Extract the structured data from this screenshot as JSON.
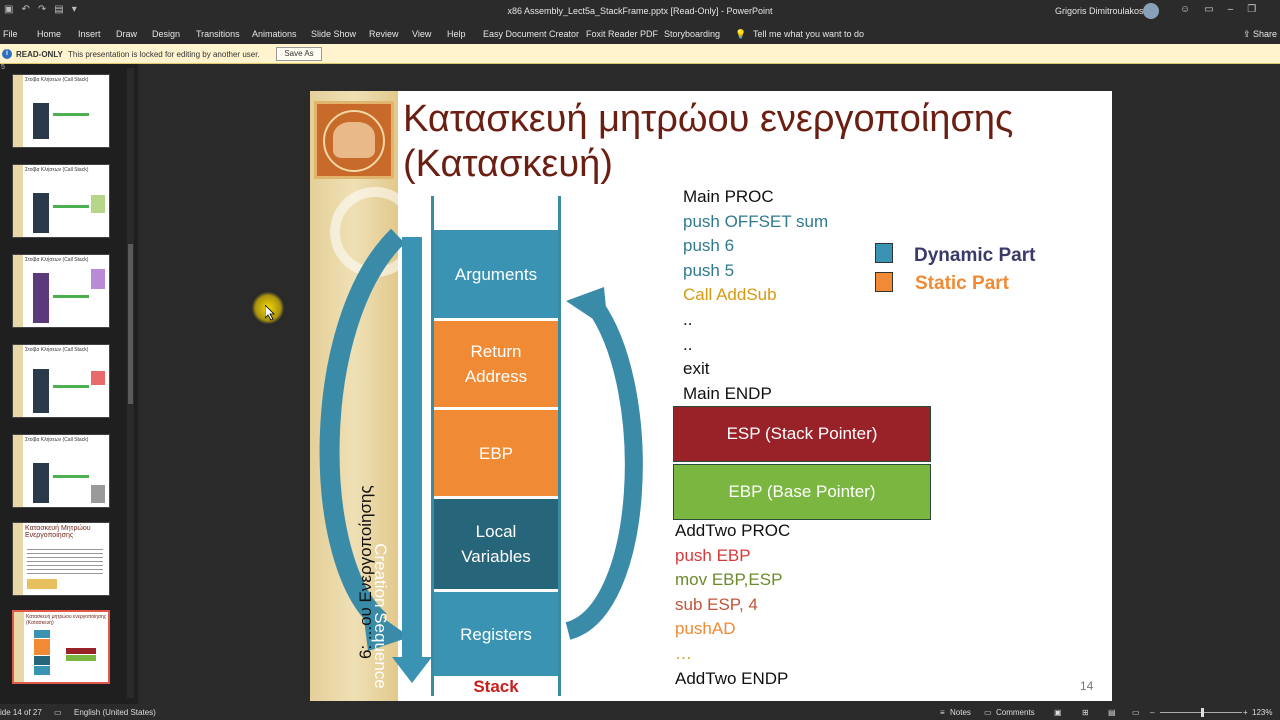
{
  "window": {
    "title": "x86 Assembly_Lect5a_StackFrame.pptx [Read-Only] - PowerPoint",
    "user": "Grigoris Dimitroulakos"
  },
  "ribbon": {
    "tabs": [
      "File",
      "Home",
      "Insert",
      "Draw",
      "Design",
      "Transitions",
      "Animations",
      "Slide Show",
      "Review",
      "View",
      "Help",
      "Easy Document Creator",
      "Foxit Reader PDF",
      "Storyboarding",
      "Tell me what you want to do"
    ],
    "share": "Share"
  },
  "readonly_bar": {
    "label": "READ-ONLY",
    "message": "This presentation is locked for editing by another user.",
    "save_as": "Save As"
  },
  "thumbnails": [
    {
      "label": "Στοίβα Κλήσεων (Call Stack)"
    },
    {
      "label": "Στοίβα Κλήσεων (Call Stack)"
    },
    {
      "label": "Στοίβα Κλήσεων (Call Stack)"
    },
    {
      "label": "Στοίβα Κλήσεων (Call Stack)"
    },
    {
      "label": "Στοίβα Κλήσεων (Call Stack)"
    },
    {
      "label": "Κατασκευή Μητρώου Ενεργοποίησης"
    },
    {
      "label": "Κατασκευή μητρώου ενεργοποίησης (Κατασκευή)"
    }
  ],
  "slide": {
    "title": "Κατασκευή μητρώου ενεργοποίησης (Κατασκευή)",
    "stack_cells": [
      {
        "text": "Arguments",
        "color": "#3a93b2"
      },
      {
        "text": "Return Address",
        "color": "#f08a34"
      },
      {
        "text": "EBP",
        "color": "#f08a34"
      },
      {
        "text": "Local Variables",
        "color": "#27667a"
      },
      {
        "text": "Registers",
        "color": "#3a93b2"
      }
    ],
    "stack_label": "Stack",
    "creation_sequence": "Creation Sequence",
    "vertical_greek": "6: ...ου Ενεργοποίησης",
    "main_code": [
      {
        "text": "Main PROC",
        "color": "#111111"
      },
      {
        "text": "push OFFSET sum",
        "color": "#2f7a8e"
      },
      {
        "text": "push 6",
        "color": "#2f7a8e"
      },
      {
        "text": "push 5",
        "color": "#2f7a8e"
      },
      {
        "text": "Call AddSub",
        "color": "#d69a12"
      },
      {
        "text": "..",
        "color": "#111111"
      },
      {
        "text": "..",
        "color": "#111111"
      },
      {
        "text": "exit",
        "color": "#111111"
      },
      {
        "text": "Main ENDP",
        "color": "#111111"
      }
    ],
    "legend": [
      {
        "text": "Dynamic Part",
        "color": "#3a93b2",
        "text_color": "#3a3a6a"
      },
      {
        "text": "Static Part",
        "color": "#f08a34",
        "text_color": "#f08a34"
      }
    ],
    "esp_box": {
      "text": "ESP (Stack Pointer)",
      "color": "#982228"
    },
    "ebp_box": {
      "text": "EBP (Base Pointer)",
      "color": "#7ab640"
    },
    "addtwo_code": [
      {
        "text": "AddTwo PROC",
        "color": "#111111"
      },
      {
        "text": "push EBP",
        "color": "#d63a3a"
      },
      {
        "text": "mov EBP,ESP",
        "color": "#6b8b2a"
      },
      {
        "text": "sub ESP, 4",
        "color": "#c0553a"
      },
      {
        "text": "pushAD",
        "color": "#f08a34"
      },
      {
        "text": "…",
        "color": "#d69a12"
      },
      {
        "text": "AddTwo ENDP",
        "color": "#111111"
      }
    ],
    "page_number": "14"
  },
  "statusbar": {
    "slide_info": "ide 14 of 27",
    "language": "English (United States)",
    "notes": "Notes",
    "comments": "Comments",
    "zoom": "123%"
  }
}
